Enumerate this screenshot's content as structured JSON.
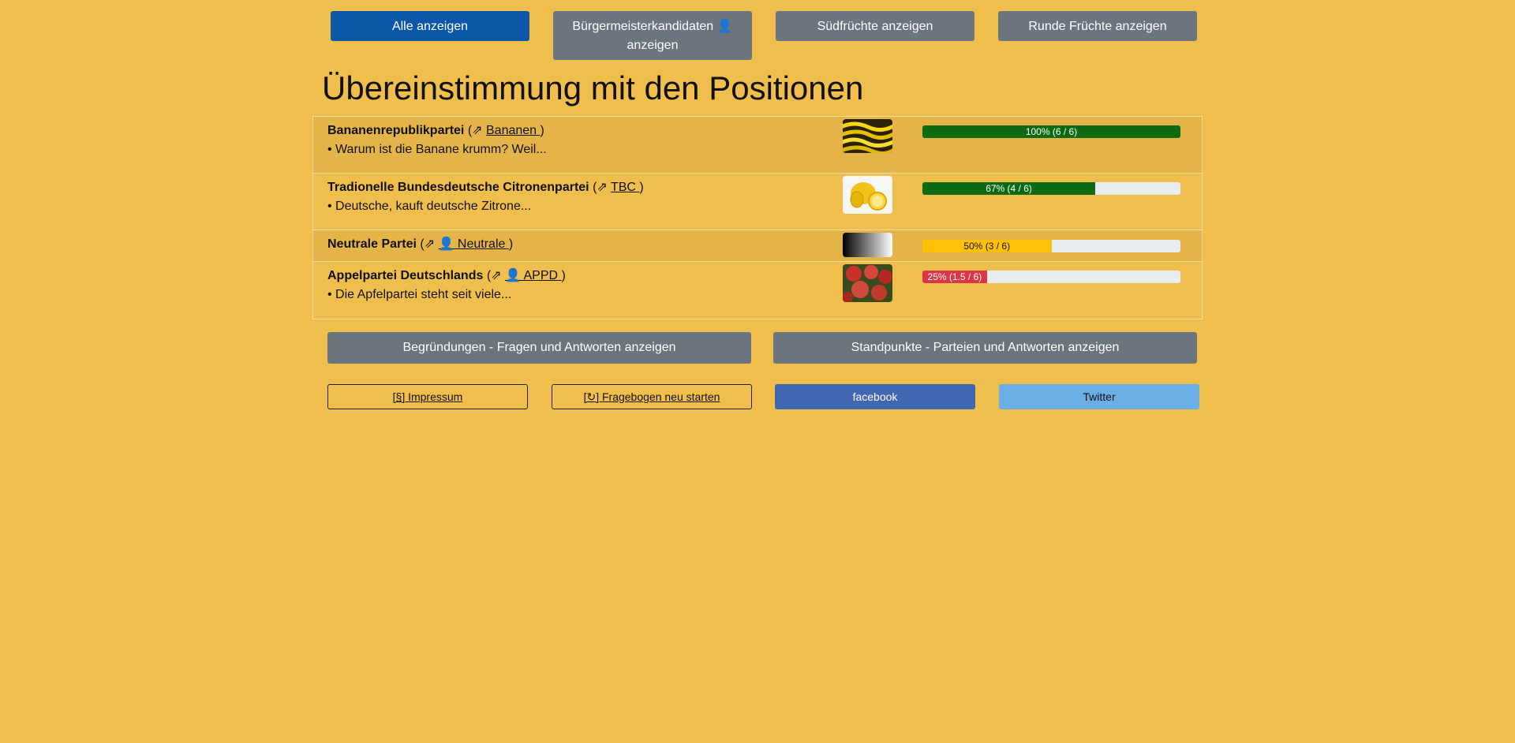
{
  "filters": [
    {
      "label": "Alle anzeigen"
    },
    {
      "label": "Bürgermeisterkandidaten 👤 anzeigen"
    },
    {
      "label": "Südfrüchte anzeigen"
    },
    {
      "label": "Runde Früchte anzeigen"
    }
  ],
  "page_title": "Übereinstimmung mit den Positionen",
  "parties": [
    {
      "name": "Bananenrepublikpartei",
      "open_paren": " (⇗ ",
      "link": "Bananen ",
      "close_paren": ")",
      "desc": "• Warum ist die Banane krumm? Weil...",
      "image": "banana-image",
      "percent_label": "100% (6 / 6)",
      "match": 1.0,
      "color": "#0c6b12"
    },
    {
      "name": "Tradionelle Bundesdeutsche Citronenpartei",
      "open_paren": " (⇗ ",
      "link": "TBC  ",
      "close_paren": ")",
      "desc": "• Deutsche, kauft deutsche Zitrone...",
      "image": "lemon-image",
      "percent_label": "67% (4 / 6)",
      "match": 0.67,
      "color": "#0c6b12"
    },
    {
      "name": "Neutrale Partei",
      "open_paren": " (⇗ ",
      "link": "👤 Neutrale ",
      "close_paren": ")",
      "desc": "",
      "image": "gradient-image",
      "percent_label": "50% (3 / 6)",
      "match": 0.5,
      "color": "#ffc107"
    },
    {
      "name": "Appelpartei Deutschlands",
      "open_paren": " (⇗ ",
      "link": "👤 APPD ",
      "close_paren": ")",
      "desc": "• Die Apfelpartei steht seit viele...",
      "image": "apple-image",
      "percent_label": "25% (1.5 / 6)",
      "match": 0.25,
      "color": "#dc3545"
    }
  ],
  "actions": {
    "reasons_label": "Begründungen - Fragen und Antworten anzeigen",
    "positions_label": "Standpunkte - Parteien und Antworten anzeigen"
  },
  "footer": {
    "impressum_label": "[§] Impressum",
    "restart_label": "[↻] Fragebogen neu starten",
    "facebook_label": "facebook",
    "twitter_label": "Twitter"
  },
  "colors": {
    "background": "#efbe4c",
    "primary": "#0b57a8",
    "secondary": "#6c757d",
    "facebook": "#4267b2",
    "twitter": "#6aafe6"
  }
}
